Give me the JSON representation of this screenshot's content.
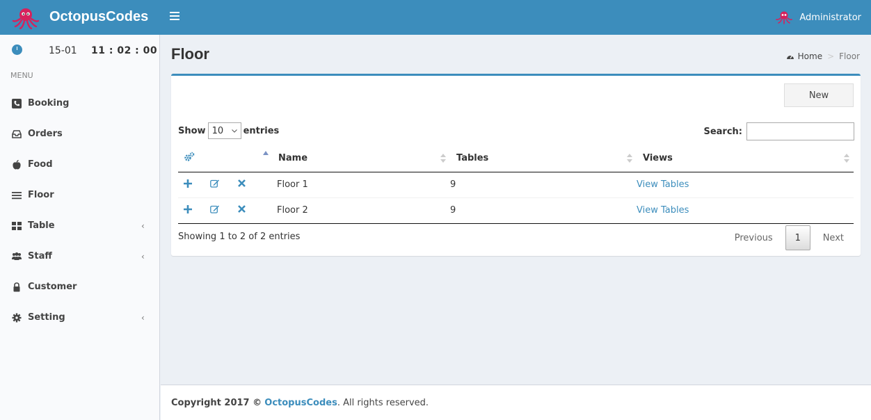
{
  "app": {
    "brand": "OctopusCodes",
    "user": "Administrator"
  },
  "sidebar": {
    "clock": {
      "date": "15-01",
      "time": "11 : 02 : 00"
    },
    "menu_header": "MENU",
    "items": [
      {
        "label": "Booking",
        "icon": "phone-icon",
        "has_children": false
      },
      {
        "label": "Orders",
        "icon": "inbox-icon",
        "has_children": false
      },
      {
        "label": "Food",
        "icon": "apple-icon",
        "has_children": false
      },
      {
        "label": "Floor",
        "icon": "list-icon",
        "has_children": false
      },
      {
        "label": "Table",
        "icon": "grid-icon",
        "has_children": true
      },
      {
        "label": "Staff",
        "icon": "users-icon",
        "has_children": true
      },
      {
        "label": "Customer",
        "icon": "lock-icon",
        "has_children": false
      },
      {
        "label": "Setting",
        "icon": "gear-icon",
        "has_children": true
      }
    ],
    "chevron": "‹"
  },
  "page": {
    "title": "Floor",
    "breadcrumb": {
      "home": "Home",
      "separator": ">",
      "current": "Floor"
    }
  },
  "box": {
    "new_label": "New",
    "show_label": "Show",
    "entries_value": "10",
    "entries_label": "entries",
    "search_label": "Search:",
    "search_value": "",
    "columns": {
      "name": "Name",
      "tables": "Tables",
      "views": "Views"
    },
    "rows": [
      {
        "name": "Floor 1",
        "tables": "9",
        "views": "View Tables"
      },
      {
        "name": "Floor 2",
        "tables": "9",
        "views": "View Tables"
      }
    ],
    "info": "Showing 1 to 2 of 2 entries",
    "pager": {
      "previous": "Previous",
      "page": "1",
      "next": "Next"
    }
  },
  "footer": {
    "prefix": "Copyright 2017 ©",
    "brand": "OctopusCodes",
    "suffix": ". All rights reserved."
  },
  "colors": {
    "primary": "#3c8dbc",
    "sidebar_bg": "#f9fafc",
    "content_bg": "#ecf0f5",
    "octopus": "#d6215c"
  }
}
